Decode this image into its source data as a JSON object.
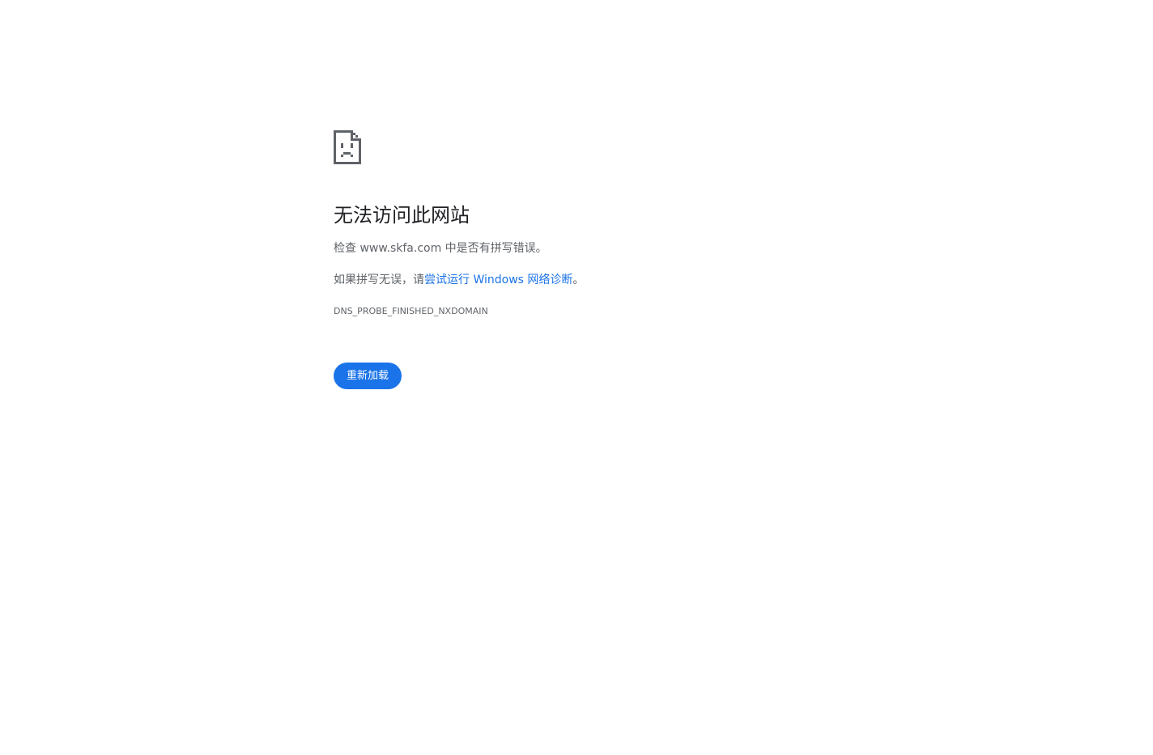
{
  "error": {
    "icon": "sad-page-icon",
    "title": "无法访问此网站",
    "check_prefix": "检查 ",
    "domain": "www.skfa.com",
    "check_suffix": " 中是否有拼写错误。",
    "hint_prefix": "如果拼写无误，请",
    "hint_link": "尝试运行 Windows 网络诊断",
    "hint_suffix": "。",
    "code": "DNS_PROBE_FINISHED_NXDOMAIN"
  },
  "actions": {
    "reload_label": "重新加载"
  },
  "colors": {
    "accent": "#1a73e8",
    "title_text": "#202124",
    "body_text": "#5f6368",
    "icon": "#5f6368"
  }
}
